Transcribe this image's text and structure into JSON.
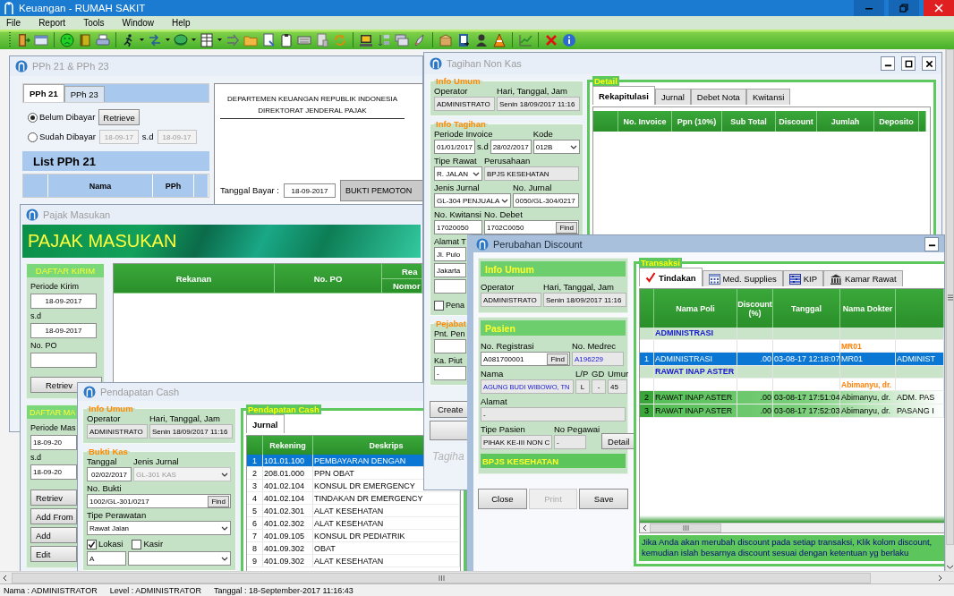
{
  "window": {
    "title": "Keuangan - RUMAH SAKIT"
  },
  "menu": [
    "File",
    "Report",
    "Tools",
    "Window",
    "Help"
  ],
  "pph_window": {
    "title": "PPh 21 & PPh 23",
    "tabs": [
      {
        "label": "PPh 21",
        "selected": true
      },
      {
        "label": "PPh 23",
        "selected": false
      }
    ],
    "filters": [
      {
        "label": "Belum Dibayar",
        "selected": true
      },
      {
        "label": "Sudah Dibayar",
        "selected": false
      }
    ],
    "retrieve_button": "Retrieve",
    "date_from": "18-09-17",
    "date_sep": "s.d",
    "date_to": "18-09-17",
    "list_title": "List PPh 21",
    "columns": [
      "Nama",
      "PPh"
    ],
    "letterhead": [
      "DEPARTEMEN KEUANGAN REPUBLIK INDONESIA",
      "DIREKTORAT JENDERAL PAJAK"
    ],
    "pay_date_label": "Tanggal Bayar :",
    "pay_date": "18-09-2017",
    "proof_button": "BUKTI PEMOTON"
  },
  "pajak_masukan": {
    "title": "Pajak Masukan",
    "banner": "PAJAK MASUKAN",
    "send_list": {
      "heading": "DAFTAR KIRIM",
      "period_label": "Periode Kirim",
      "from": "18-09-2017",
      "sep": "s.d",
      "to": "18-09-2017",
      "po_label": "No. PO",
      "button": "Retriev"
    },
    "second_list": {
      "heading": "DAFTAR MA",
      "period_label": "Periode Mas",
      "from": "18-09-20",
      "sep": "s.d",
      "to": "18-09-20",
      "buttons": [
        "Retriev",
        "Add From",
        "Add",
        "Edit"
      ]
    },
    "columns": [
      "Rekanan",
      "No. PO",
      "Rea"
    ],
    "subcolumn": "Nomor"
  },
  "tagihan_non_kas": {
    "title": "Tagihan Non Kas",
    "info_umum": {
      "legend": "Info Umum",
      "operator_label": "Operator",
      "datetime_label": "Hari, Tanggal, Jam",
      "operator": "ADMINISTRATO",
      "datetime": "Senin 18/09/2017 11:16"
    },
    "info_tagihan": {
      "legend": "Info Tagihan",
      "period_label": "Periode Invoice",
      "period_from": "01/01/2017",
      "period_sep": "s.d",
      "period_to": "28/02/2017",
      "code_label": "Kode",
      "code": "012B",
      "care_type_label": "Tipe Rawat",
      "care_type": "R. JALAN",
      "company_label": "Perusahaan",
      "company": "BPJS KESEHATAN",
      "journal_type_label": "Jenis Jurnal",
      "journal_type": "GL-304 PENJUALA",
      "journal_no_label": "No. Jurnal",
      "journal_no": "0050/GL-304/0217",
      "receipt_no_label": "No. Kwitansi",
      "receipt_no": "17020050",
      "debit_no_label": "No. Debet",
      "debit_no": "1702C0050",
      "find_button": "Find",
      "address_label": "Alamat T",
      "address_lines": [
        "Jl. Pulo",
        "Jakarta"
      ],
      "biller": {
        "label": "Pena",
        "checked": false
      }
    },
    "pejabat": {
      "legend": "Pejabat",
      "signer_label": "Pnt. Pen",
      "head_label": "Ka. Piut",
      "head": "-"
    },
    "create_button": "Create",
    "caption": "Tagiha",
    "detail": {
      "legend": "Detail",
      "tabs": [
        {
          "label": "Rekapitulasi",
          "selected": true
        },
        {
          "label": "Jurnal",
          "selected": false
        },
        {
          "label": "Debet Nota",
          "selected": false
        },
        {
          "label": "Kwitansi",
          "selected": false
        }
      ],
      "columns": [
        "No. Invoice",
        "Ppn (10%)",
        "Sub Total",
        "Discount",
        "Jumlah",
        "Deposito"
      ]
    }
  },
  "pendapatan_cash": {
    "title": "Pendapatan Cash",
    "info_umum": {
      "legend": "Info Umum",
      "operator_label": "Operator",
      "datetime_label": "Hari, Tanggal, Jam",
      "operator": "ADMINISTRATO",
      "datetime": "Senin 18/09/2017 11:16"
    },
    "bukti_kas": {
      "legend": "Bukti Kas",
      "date_label": "Tanggal",
      "date": "02/02/2017",
      "journal_type_label": "Jenis Jurnal",
      "journal_type": "GL-301 KAS",
      "journal_type_disabled": true,
      "proof_no_label": "No. Bukti",
      "proof_no": "1002/GL-301/0217",
      "find_button": "Find",
      "care_type_label": "Tipe Perawatan",
      "care_type": "Rawat Jalan",
      "options": [
        {
          "label": "Lokasi",
          "checked": true
        },
        {
          "label": "Kasir",
          "checked": false
        }
      ],
      "location": "A"
    },
    "journal": {
      "legend": "Pendapatan Cash",
      "tabs": [
        {
          "label": "Jurnal",
          "selected": true
        }
      ],
      "columns": [
        "Rekening",
        "Deskrips"
      ],
      "rows": [
        {
          "no": "1",
          "account": "101.01.100",
          "description": "PEMBAYARAN DENGAN",
          "selected": true
        },
        {
          "no": "2",
          "account": "208.01.000",
          "description": "PPN OBAT",
          "selected": false
        },
        {
          "no": "3",
          "account": "401.02.104",
          "description": "KONSUL DR EMERGENCY",
          "selected": false
        },
        {
          "no": "4",
          "account": "401.02.104",
          "description": "TINDAKAN DR EMERGENCY",
          "selected": false
        },
        {
          "no": "5",
          "account": "401.02.301",
          "description": "ALAT KESEHATAN",
          "selected": false
        },
        {
          "no": "6",
          "account": "401.02.302",
          "description": "ALAT KESEHATAN",
          "selected": false
        },
        {
          "no": "7",
          "account": "401.09.105",
          "description": "KONSUL DR PEDIATRIK",
          "selected": false
        },
        {
          "no": "8",
          "account": "401.09.302",
          "description": "OBAT",
          "selected": false
        },
        {
          "no": "9",
          "account": "401.09.302",
          "description": "ALAT KESEHATAN",
          "selected": false
        }
      ]
    }
  },
  "perubahan_discount": {
    "title": "Perubahan Discount",
    "info_umum": {
      "legend": "Info Umum",
      "operator_label": "Operator",
      "datetime_label": "Hari, Tanggal, Jam",
      "operator": "ADMINISTRATO",
      "datetime": "Senin 18/09/2017 11:16"
    },
    "pasien": {
      "legend": "Pasien",
      "registration_label": "No. Registrasi",
      "registration": "A081700001",
      "find_button": "Find",
      "medrec_label": "No. Medrec",
      "medrec": "A196229",
      "name_label": "Nama",
      "name": "AGUNG BUDI WIBOWO, TN",
      "sex_label": "L/P",
      "sex": "L",
      "gd_label": "GD",
      "gd": "-",
      "age_label": "Umur",
      "age": "45",
      "address_label": "Alamat",
      "address": "-",
      "patient_type_label": "Tipe Pasien",
      "patient_type": "PIHAK KE-III NON C",
      "employee_no_label": "No Pegawai",
      "employee_no": "-",
      "detail_button": "Detail",
      "insurer": "BPJS KESEHATAN"
    },
    "buttons": [
      {
        "label": "Close",
        "disabled": false
      },
      {
        "label": "Print",
        "disabled": true
      },
      {
        "label": "Save",
        "disabled": false
      }
    ],
    "transaksi": {
      "legend": "Transaksi",
      "tabs": [
        {
          "label": "Tindakan",
          "selected": true
        },
        {
          "label": "Med. Supplies",
          "selected": false
        },
        {
          "label": "KIP",
          "selected": false
        },
        {
          "label": "Kamar Rawat",
          "selected": false
        }
      ],
      "columns": [
        "Nama Poli",
        "Discount (%)",
        "Tanggal",
        "Nama Dokter"
      ],
      "rows": [
        {
          "kind": "group",
          "label": "ADMINISTRASI",
          "selected": false
        },
        {
          "kind": "doctor",
          "label": "MR01",
          "selected": false
        },
        {
          "kind": "item",
          "no": "1",
          "poli": "ADMINISTRASI",
          "discount": ".00",
          "date": "03-08-17 12:18:07",
          "doctor": "MR01",
          "action": "ADMINIST",
          "selected": true
        },
        {
          "kind": "group",
          "label": "RAWAT INAP ASTER",
          "selected": false
        },
        {
          "kind": "doctor",
          "label": "Abimanyu, dr.",
          "selected": false
        },
        {
          "kind": "item",
          "no": "2",
          "poli": "RAWAT INAP ASTER",
          "discount": ".00",
          "date": "03-08-17 17:51:04",
          "doctor": "Abimanyu, dr.",
          "action": "ADM. PAS",
          "selected": false
        },
        {
          "kind": "item",
          "no": "3",
          "poli": "RAWAT INAP ASTER",
          "discount": ".00",
          "date": "03-08-17 17:52:03",
          "doctor": "Abimanyu, dr.",
          "action": "PASANG I",
          "selected": false
        }
      ],
      "note": "Jika Anda akan merubah discount pada setiap transaksi,  Klik kolom discount, kemudian islah besarnya discount sesuai dengan ketentuan yg berlaku"
    }
  },
  "status_bar": {
    "user": "Nama : ADMINISTRATOR",
    "level": "Level : ADMINISTRATOR",
    "date": "Tanggal : 18-September-2017 11:16:43"
  }
}
